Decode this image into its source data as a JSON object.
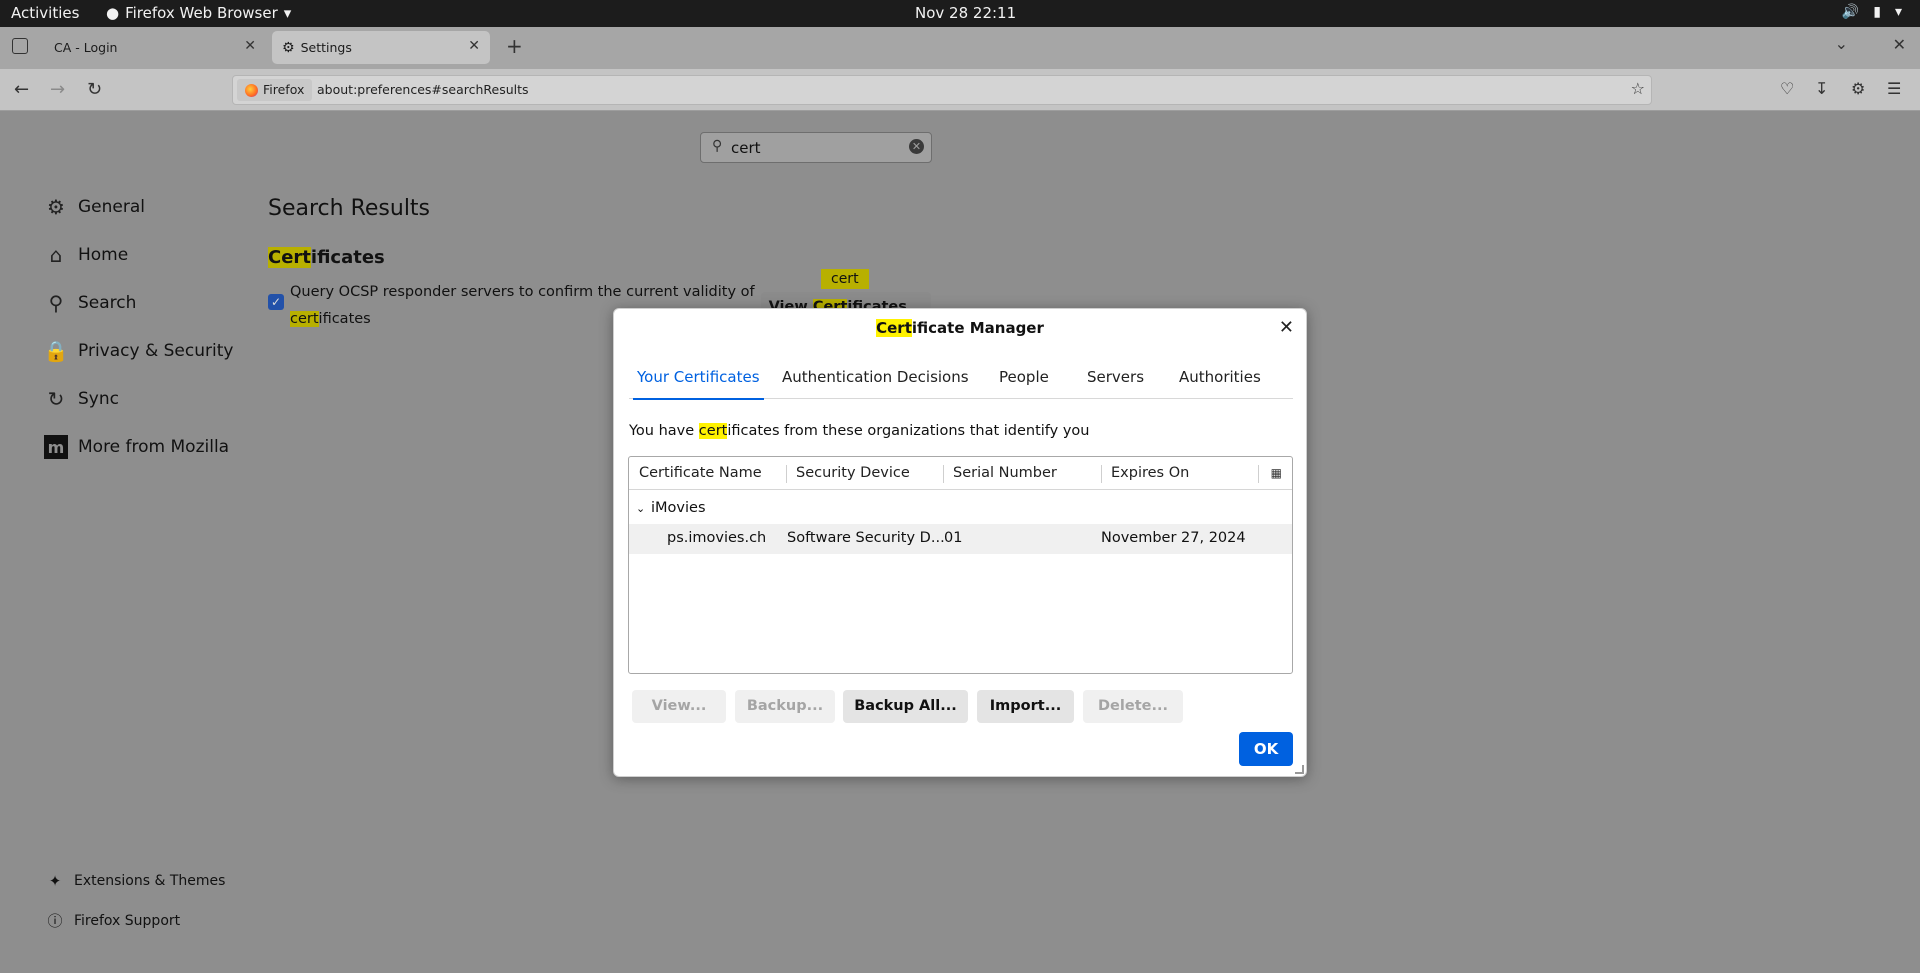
{
  "topbar": {
    "activities": "Activities",
    "app_menu": "Firefox Web Browser",
    "clock": "Nov 28  22:11"
  },
  "tabs": [
    {
      "label": "CA - Login",
      "active": false
    },
    {
      "label": "Settings",
      "active": true
    }
  ],
  "urlbar": {
    "identity": "Firefox",
    "url": "about:preferences#searchResults"
  },
  "settings": {
    "search_value": "cert",
    "sidebar": [
      {
        "label": "General",
        "icon": "gear-icon"
      },
      {
        "label": "Home",
        "icon": "home-icon"
      },
      {
        "label": "Search",
        "icon": "search-icon"
      },
      {
        "label": "Privacy & Security",
        "icon": "lock-icon"
      },
      {
        "label": "Sync",
        "icon": "sync-icon"
      },
      {
        "label": "More from Mozilla",
        "icon": "mozilla-icon"
      }
    ],
    "footer": [
      {
        "label": "Extensions & Themes",
        "icon": "puzzle-icon"
      },
      {
        "label": "Firefox Support",
        "icon": "help-icon"
      }
    ],
    "results_title": "Search Results",
    "section": {
      "hl": "Cert",
      "rest": "ificates"
    },
    "ocsp": {
      "text": "Query OCSP responder servers to confirm the current validity of ",
      "hl": "cert",
      "tail": "ificates",
      "checked": true
    },
    "view_certs": {
      "badge": "cert",
      "pre": "View ",
      "hl": "Cert",
      "post": "ificates..."
    }
  },
  "dialog": {
    "title": {
      "hl": "Cert",
      "rest": "ificate Manager"
    },
    "tabs": [
      {
        "label": "Your Certificates",
        "selected": true
      },
      {
        "label": "Authentication Decisions",
        "selected": false
      },
      {
        "label": "People",
        "selected": false
      },
      {
        "label": "Servers",
        "selected": false
      },
      {
        "label": "Authorities",
        "selected": false
      }
    ],
    "intro": {
      "pre": "You have ",
      "hl": "cert",
      "post": "ificates from these organizations that identify you"
    },
    "columns": [
      "Certificate Name",
      "Security Device",
      "Serial Number",
      "Expires On"
    ],
    "group": "iMovies",
    "rows": [
      {
        "name": "ps.imovies.ch",
        "device": "Software Security D...",
        "serial": "01",
        "expires": "November 27, 2024"
      }
    ],
    "buttons": [
      {
        "label": "View...",
        "enabled": false
      },
      {
        "label": "Backup...",
        "enabled": false
      },
      {
        "label": "Backup All...",
        "enabled": true
      },
      {
        "label": "Import...",
        "enabled": true
      },
      {
        "label": "Delete...",
        "enabled": false
      }
    ],
    "ok": "OK"
  },
  "colors": {
    "accent": "#0061e0",
    "highlight": "#fff200",
    "dim_highlight": "#b8b000"
  }
}
